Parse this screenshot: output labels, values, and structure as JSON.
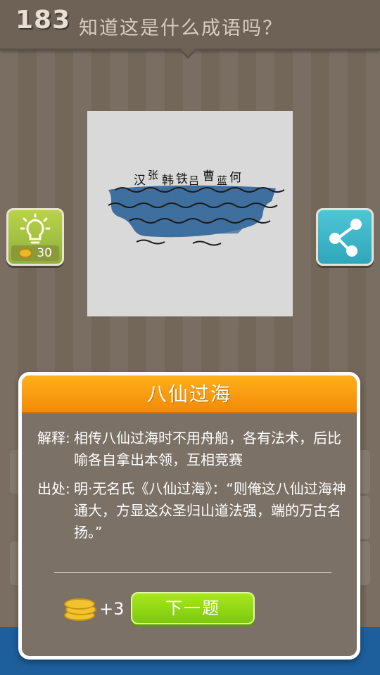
{
  "header": {
    "level": "183",
    "question": "知道这是什么成语吗？"
  },
  "puzzle": {
    "names": [
      "汉",
      "张",
      "韩",
      "铁",
      "吕",
      "曹",
      "蓝",
      "何"
    ]
  },
  "hint": {
    "cost": "30",
    "icon": "lightbulb-icon"
  },
  "share": {
    "icon": "share-icon"
  },
  "dialog": {
    "title": "八仙过海",
    "explain_label": "解释:",
    "explain_text": "相传八仙过海时不用舟船，各有法术，后比喻各自拿出本领，互相竞赛",
    "source_label": "出处:",
    "source_text": "明·无名氏《八仙过海》：“则俺这八仙过海神通大，方显这众圣归山道法强，端的万古名扬。”",
    "reward": "+3",
    "next_button": "下一题"
  },
  "colors": {
    "header_orange": "#f28a08",
    "next_green": "#7cc90e",
    "hint_green": "#8fb13a",
    "share_teal": "#2fa6bb"
  }
}
